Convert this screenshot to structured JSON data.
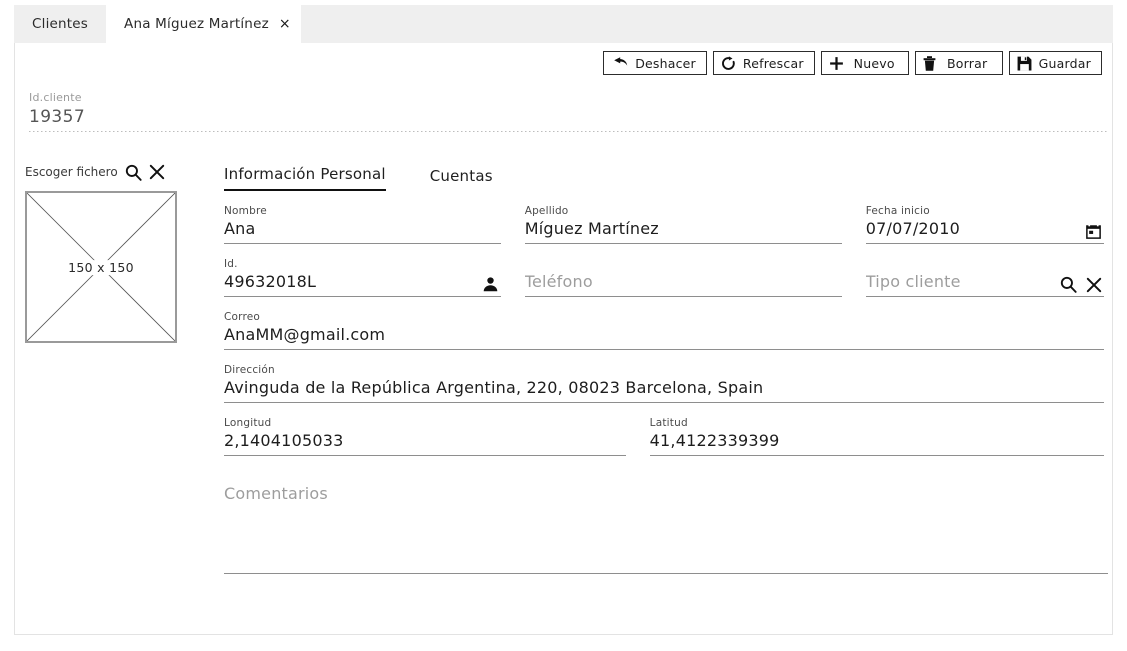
{
  "tabs": [
    {
      "label": "Clientes",
      "active": false,
      "closable": false
    },
    {
      "label": "Ana Míguez Martínez",
      "active": true,
      "closable": true,
      "close_glyph": "×"
    }
  ],
  "toolbar": {
    "buttons": [
      {
        "label": "Deshacer",
        "icon": "undo-icon"
      },
      {
        "label": "Refrescar",
        "icon": "refresh-icon"
      },
      {
        "label": "Nuevo",
        "icon": "plus-icon"
      },
      {
        "label": "Borrar",
        "icon": "trash-icon"
      },
      {
        "label": "Guardar",
        "icon": "save-icon"
      }
    ]
  },
  "header": {
    "id_caption": "Id.cliente",
    "id_value": "19357"
  },
  "image_picker": {
    "label": "Escoger fichero",
    "search_icon": "search-icon",
    "clear_icon": "clear-icon",
    "placeholder_dims": "150 x 150"
  },
  "subtabs": [
    {
      "label": "Información Personal",
      "active": true
    },
    {
      "label": "Cuentas",
      "active": false
    }
  ],
  "fields": {
    "nombre": {
      "caption": "Nombre",
      "value": "Ana",
      "placeholder": ""
    },
    "apellido": {
      "caption": "Apellido",
      "value": "Míguez Martínez",
      "placeholder": ""
    },
    "fecha": {
      "caption": "Fecha inicio",
      "value": "07/07/2010",
      "placeholder": "",
      "icon": "calendar-icon"
    },
    "id": {
      "caption": "Id.",
      "value": "49632018L",
      "placeholder": "",
      "icon": "person-icon"
    },
    "telefono": {
      "caption": "",
      "value": "",
      "placeholder": "Teléfono"
    },
    "tipo": {
      "caption": "",
      "value": "",
      "placeholder": "Tipo cliente",
      "icon": "search-icon",
      "icon2": "clear-icon"
    },
    "correo": {
      "caption": "Correo",
      "value": "AnaMM@gmail.com",
      "placeholder": ""
    },
    "direccion": {
      "caption": "Dirección",
      "value": "Avinguda de la República Argentina, 220, 08023 Barcelona, Spain",
      "placeholder": ""
    },
    "longitud": {
      "caption": "Longitud",
      "value": "2,1404105033",
      "placeholder": ""
    },
    "latitud": {
      "caption": "Latitud",
      "value": "41,4122339399",
      "placeholder": ""
    },
    "comentarios": {
      "caption": "",
      "value": "",
      "placeholder": "Comentarios"
    }
  },
  "colors": {
    "tabbar_bg": "#efefef",
    "active_tab_bg": "#ffffff",
    "panel_border": "#e3e3e3",
    "field_underline": "#8e8e8e",
    "caption_text": "#4a4a4a",
    "value_text": "#1d1d1d",
    "placeholder_text": "#9d9d9d",
    "button_border": "#2c2c2c",
    "id_value_text": "#555555"
  }
}
